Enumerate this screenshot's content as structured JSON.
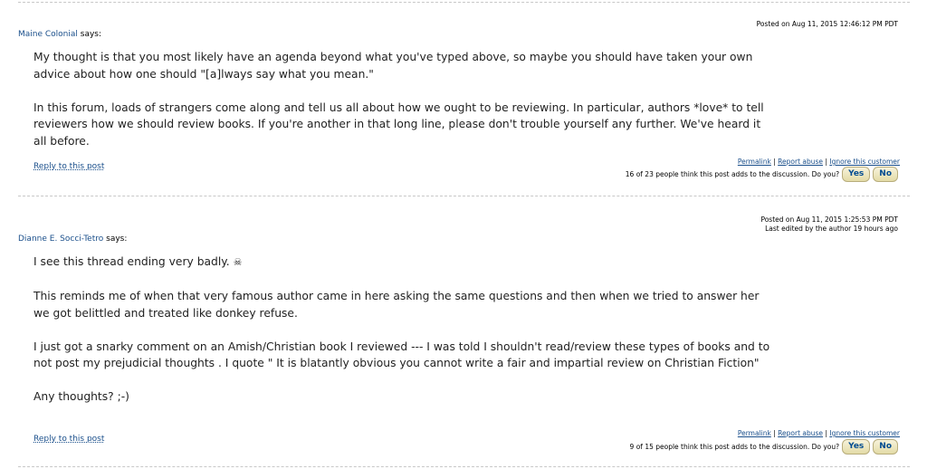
{
  "posts": [
    {
      "posted": "Posted on Aug 11, 2015 12:46:12 PM PDT",
      "edited": "",
      "author": "Maine Colonial",
      "says": "says:",
      "paragraphs": [
        "My thought is that you most likely have an agenda beyond what you've typed above, so maybe you should have taken your own advice about how one should \"[a]lways say what you mean.\"",
        "In this forum, loads of strangers come along and tell us all about how we ought to be reviewing. In particular, authors *love* to tell reviewers how we should review books. If you're another in that long line, please don't trouble yourself any further. We've heard it all before."
      ],
      "reply": "Reply to this post",
      "permalink": "Permalink",
      "report": "Report abuse",
      "ignore": "Ignore this customer",
      "vote_text": "16 of 23 people think this post adds to the discussion. Do you?",
      "yes": "Yes",
      "no": "No"
    },
    {
      "posted": "Posted on Aug 11, 2015 1:25:53 PM PDT",
      "edited": "Last edited by the author 19 hours ago",
      "author": "Dianne E. Socci-Tetro",
      "says": "says:",
      "first_line": "I see this thread ending very badly.",
      "paragraphs": [
        "This reminds me of when that very famous author came in here asking the same questions and then when we tried to answer her we got belittled and treated like donkey refuse.",
        "I just got a snarky comment on an Amish/Christian book I reviewed --- I was told I shouldn't read/review these types of books and to not post my prejudicial thoughts . I quote \" It is blatantly obvious you cannot write a fair and impartial review on Christian Fiction\"",
        "Any thoughts? ;-)"
      ],
      "reply": "Reply to this post",
      "permalink": "Permalink",
      "report": "Report abuse",
      "ignore": "Ignore this customer",
      "vote_text": "9 of 15 people think this post adds to the discussion. Do you?",
      "yes": "Yes",
      "no": "No"
    }
  ],
  "sep": "|"
}
